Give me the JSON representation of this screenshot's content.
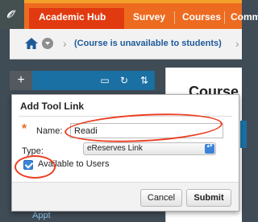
{
  "app": {
    "logo_glyph": "𝒪"
  },
  "tabs": [
    {
      "label": "Academic Hub",
      "active": true
    },
    {
      "label": "Survey",
      "active": false
    },
    {
      "label": "Courses",
      "active": false
    },
    {
      "label": "Commu",
      "active": false
    }
  ],
  "breadcrumb": {
    "separator": "›",
    "text": "(Course is unavailable to students)"
  },
  "toolbar": {
    "add_glyph": "+",
    "folder_glyph": "▭",
    "refresh_glyph": "↻",
    "sort_glyph": "⇅"
  },
  "content": {
    "title": "Course"
  },
  "sidebar": {
    "link_label": "Appt"
  },
  "dialog": {
    "title": "Add Tool Link",
    "required_mark": "*",
    "name_label": "Name:",
    "name_value": "Readi",
    "type_label": "Type:",
    "type_value": "eReserves Link",
    "type_arrow": "▴▾",
    "available_label": "Available to Users",
    "available_checked": true,
    "cancel_label": "Cancel",
    "submit_label": "Submit"
  },
  "colors": {
    "tab_bar": "#ed6b21",
    "active_tab": "#e13a10",
    "toolbar": "#1a6fa3",
    "annotation": "#ea3f23",
    "checkbox": "#3b83d8"
  }
}
